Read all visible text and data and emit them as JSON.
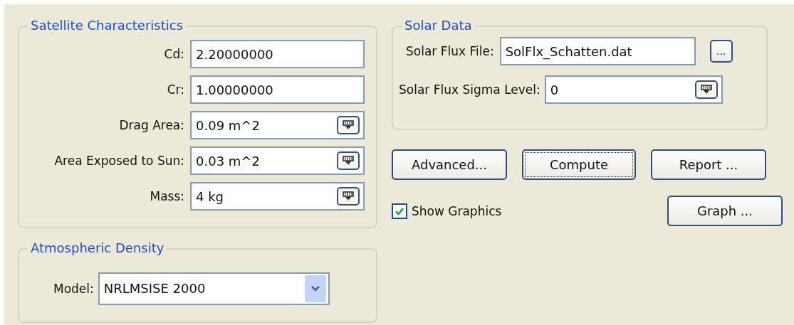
{
  "satellite_characteristics": {
    "title": "Satellite Characteristics",
    "fields": [
      {
        "label": "Cd:",
        "value": "2.20000000",
        "kind": "plain"
      },
      {
        "label": "Cr:",
        "value": "1.00000000",
        "kind": "plain"
      },
      {
        "label": "Drag Area:",
        "value": "0.09 m^2",
        "kind": "units"
      },
      {
        "label": "Area Exposed to Sun:",
        "value": "0.03 m^2",
        "kind": "units"
      },
      {
        "label": "Mass:",
        "value": "4 kg",
        "kind": "units"
      }
    ]
  },
  "atmospheric_density": {
    "title": "Atmospheric Density",
    "model": {
      "label": "Model:",
      "value": "NRLMSISE 2000"
    }
  },
  "solar_data": {
    "title": "Solar Data",
    "flux_file": {
      "label": "Solar Flux File:",
      "value": "SolFlx_Schatten.dat",
      "browse": "..."
    },
    "sigma_level": {
      "label": "Solar Flux Sigma Level:",
      "value": "0"
    }
  },
  "buttons": [
    {
      "label": "Advanced...",
      "focused": false
    },
    {
      "label": "Compute",
      "focused": true
    },
    {
      "label": "Report ...",
      "focused": false
    }
  ],
  "show_graphics": {
    "label": "Show Graphics",
    "checked": true
  },
  "graph_button": {
    "label": "Graph ..."
  }
}
